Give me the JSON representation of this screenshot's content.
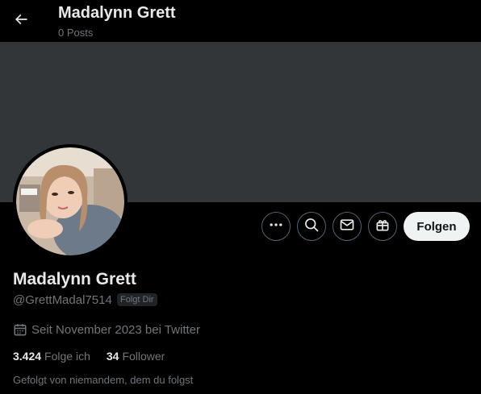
{
  "header": {
    "title": "Madalynn Grett",
    "posts_count": "0 Posts"
  },
  "icons": {
    "back": "arrow-left-icon",
    "more": "more-dots-icon",
    "search": "search-icon",
    "message": "mail-icon",
    "subscribe": "gift-icon",
    "calendar": "calendar-icon"
  },
  "colors": {
    "background": "#000000",
    "banner": "#333639",
    "primary_text": "#e7e9ea",
    "secondary_text": "#71767b",
    "follow_button_bg": "#eff3f4",
    "button_border": "#536471"
  },
  "profile": {
    "display_name": "Madalynn Grett",
    "handle": "@GrettMadal7514",
    "follows_you_badge": "Folgt Dir",
    "joined": "Seit November 2023 bei Twitter",
    "following_count": "3.424",
    "following_label": "Folge ich",
    "followers_count": "34",
    "followers_label": "Follower",
    "followed_by": "Gefolgt von niemandem, dem du folgst"
  },
  "actions": {
    "follow_label": "Folgen"
  }
}
